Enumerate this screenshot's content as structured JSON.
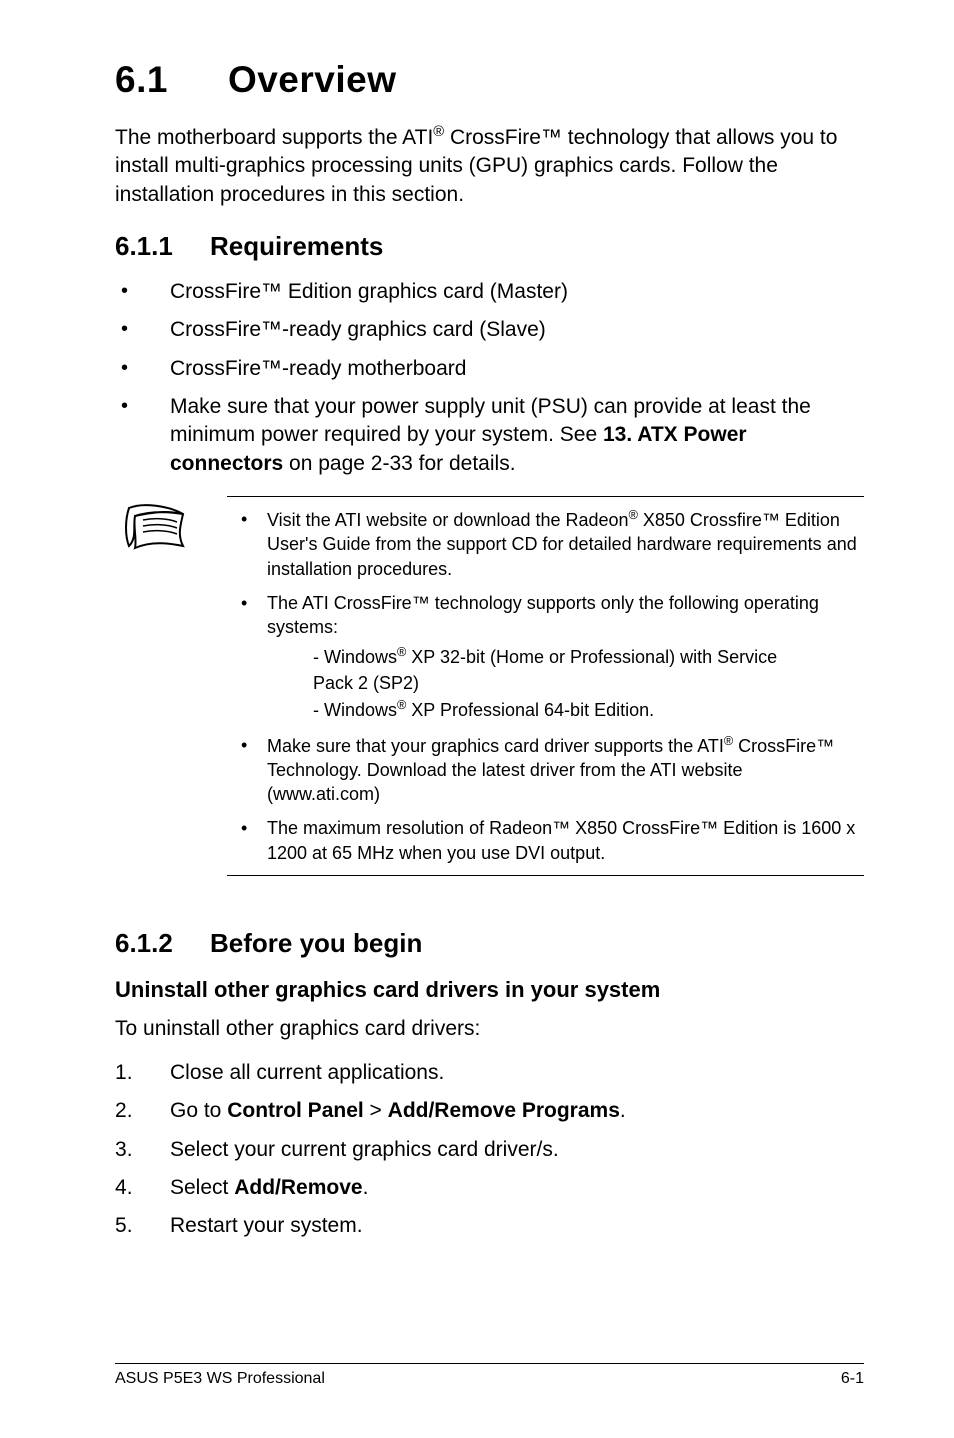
{
  "h1_num": "6.1",
  "h1_title": "Overview",
  "intro_a": "The motherboard supports the ATI",
  "intro_reg1": "®",
  "intro_b": " CrossFire™ technology that allows you to install multi-graphics processing units (GPU) graphics cards. Follow the installation procedures in this section.",
  "h2a_num": "6.1.1",
  "h2a_title": "Requirements",
  "req1": "CrossFire™ Edition graphics card (Master)",
  "req2": "CrossFire™-ready graphics card (Slave)",
  "req3": "CrossFire™-ready motherboard",
  "req4_a": "Make sure that your power supply unit (PSU) can provide at least the minimum power required by your system. See ",
  "req4_bold": "13. ATX Power connectors",
  "req4_b": " on page 2-33 for details.",
  "note1_a": "Visit the ATI website or download the Radeon",
  "note1_reg": "®",
  "note1_b": " X850 Crossfire™ Edition User's Guide from the support CD for detailed hardware requirements and installation procedures.",
  "note2": "The ATI CrossFire™ technology supports only the following operating systems:",
  "note2_s1_a": "- Windows",
  "note2_s1_reg": "®",
  "note2_s1_b": " XP 32-bit  (Home or Professional) with Service",
  "note2_s1_c": "  Pack 2 (SP2)",
  "note2_s2_a": "- Windows",
  "note2_s2_reg": "®",
  "note2_s2_b": " XP Professional 64-bit Edition.",
  "note3_a": "Make sure that your graphics card driver supports the ATI",
  "note3_reg": "®",
  "note3_b": " CrossFire™ Technology. Download the latest driver from the ATI website (www.ati.com)",
  "note4": "The maximum resolution of Radeon™ X850 CrossFire™ Edition is 1600 x 1200 at 65 MHz when you use DVI output.",
  "h2b_num": "6.1.2",
  "h2b_title": "Before you begin",
  "h3": "Uninstall other graphics card drivers in your system",
  "uninstall_intro": "To uninstall other graphics card drivers:",
  "step1": "Close all current applications.",
  "step2_a": "Go to ",
  "step2_b1": "Control Panel",
  "step2_sep": " > ",
  "step2_b2": "Add/Remove Programs",
  "step2_end": ".",
  "step3": "Select your current graphics card driver/s.",
  "step4_a": "Select ",
  "step4_b": "Add/Remove",
  "step4_end": ".",
  "step5": "Restart your system.",
  "footer_left": "ASUS P5E3 WS Professional",
  "footer_right": "6-1"
}
